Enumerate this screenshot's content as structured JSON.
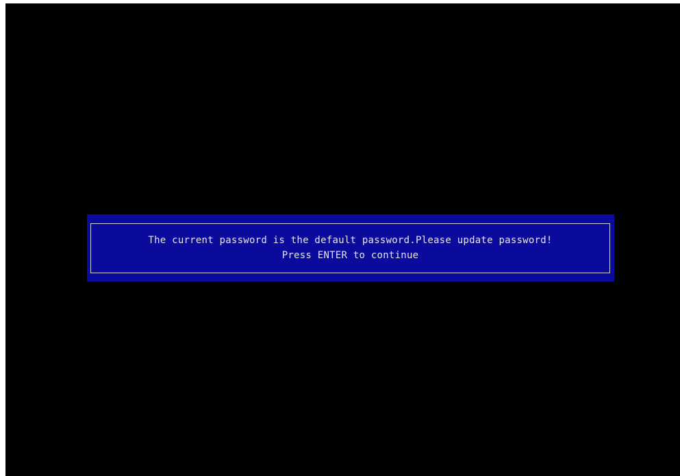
{
  "dialog": {
    "message": "The current password is the default password.Please update password!",
    "prompt": "Press ENTER to continue"
  },
  "colors": {
    "screen_background": "#000000",
    "dialog_background": "#0a0a9c",
    "text": "#e6e6e6",
    "border": "#d0d0e0"
  }
}
